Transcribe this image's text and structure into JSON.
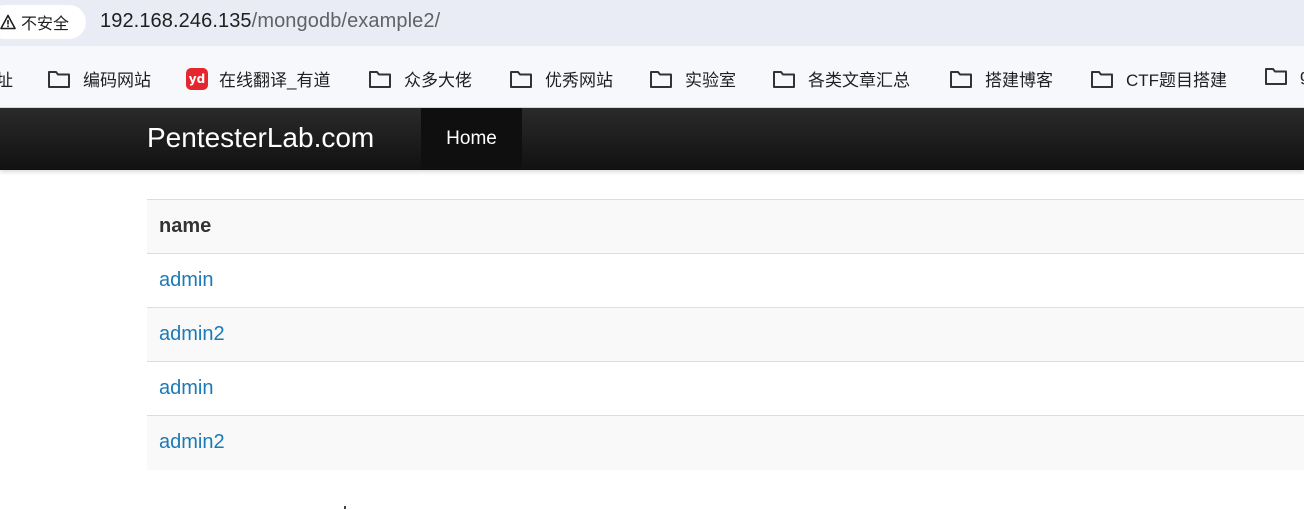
{
  "browser": {
    "security_label": "不安全",
    "url_host": "192.168.246.135",
    "url_path": "/mongodb/example2/"
  },
  "bookmarks": [
    {
      "label": "址",
      "icon": "none"
    },
    {
      "label": "编码网站",
      "icon": "folder-icon"
    },
    {
      "label": "在线翻译_有道",
      "icon": "youdao-icon",
      "icon_text": "yd"
    },
    {
      "label": "众多大佬",
      "icon": "folder-icon"
    },
    {
      "label": "优秀网站",
      "icon": "folder-icon"
    },
    {
      "label": "实验室",
      "icon": "folder-icon"
    },
    {
      "label": "各类文章汇总",
      "icon": "folder-icon"
    },
    {
      "label": "搭建博客",
      "icon": "folder-icon"
    },
    {
      "label": "CTF题目搭建",
      "icon": "folder-icon"
    },
    {
      "label": "g",
      "icon": "folder-icon"
    }
  ],
  "navbar": {
    "brand": "PentesterLab.com",
    "home_label": "Home"
  },
  "table": {
    "header": "name",
    "rows": [
      "admin",
      "admin2",
      "admin",
      "admin2"
    ]
  },
  "colors": {
    "link": "#1a7ab8",
    "navbar": "#1a1a1a",
    "addressbar": "#e9ecf5"
  }
}
